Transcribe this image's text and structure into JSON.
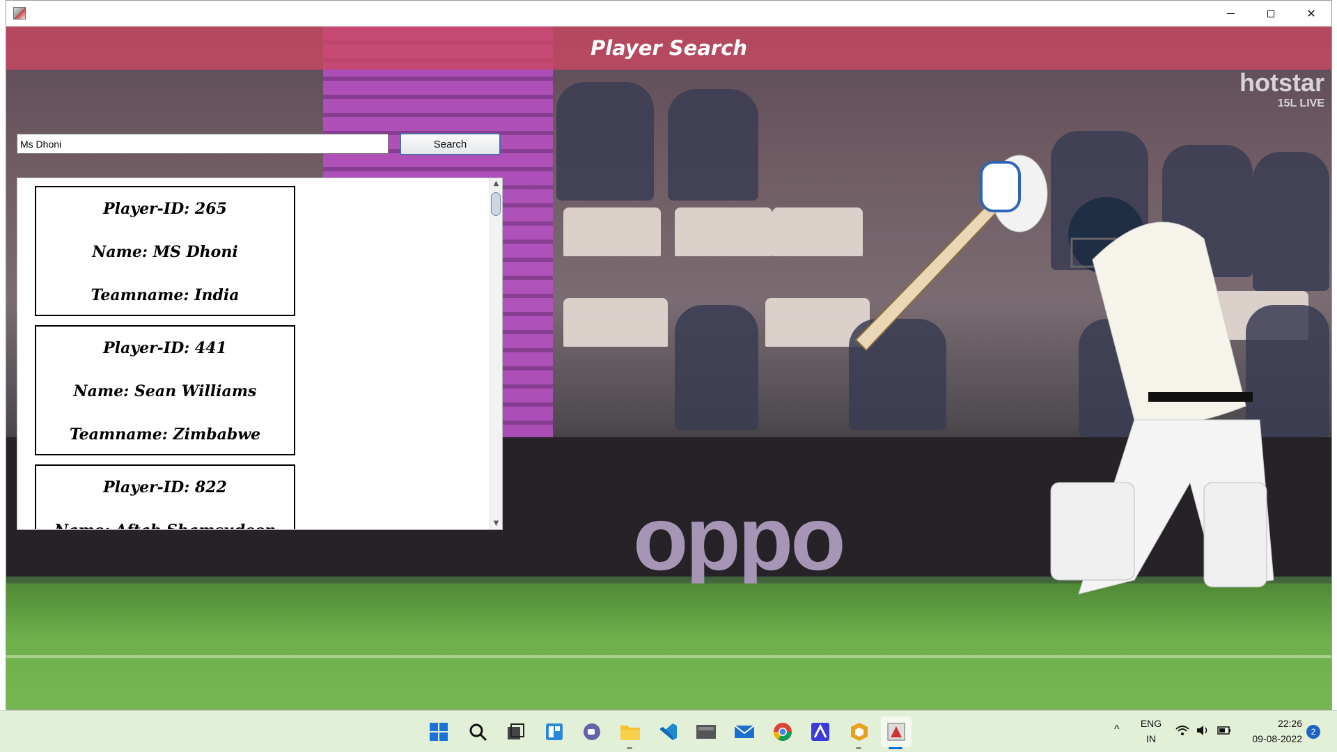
{
  "window": {
    "header_title": "Player Search",
    "watermark_logo": "hotstar",
    "watermark_live": "15L LIVE",
    "ad_text": "oppo"
  },
  "search": {
    "value": "Ms Dhoni",
    "button_label": "Search"
  },
  "results": [
    {
      "id_line": "Player-ID: 265",
      "name_line": "Name: MS Dhoni",
      "team_line": "Teamname: India"
    },
    {
      "id_line": "Player-ID: 441",
      "name_line": "Name: Sean Williams",
      "team_line": "Teamname: Zimbabwe"
    },
    {
      "id_line": "Player-ID: 822",
      "name_line": "Name: Aftab Shamsudeen",
      "team_line": ""
    }
  ],
  "taskbar": {
    "language": "ENG",
    "region": "IN",
    "time": "22:26",
    "date": "09-08-2022",
    "notification_count": "2",
    "colors": {
      "accent": "#0a6ed1",
      "taskbar_bg": "#e3f0d8",
      "header_band": "#cd4862"
    }
  }
}
